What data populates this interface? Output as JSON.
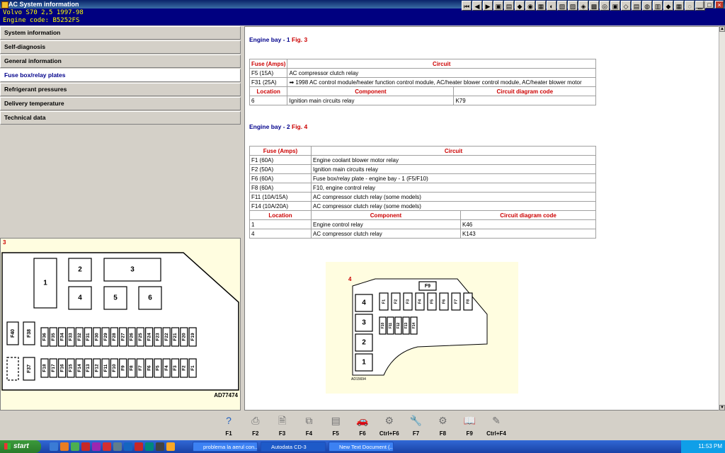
{
  "window": {
    "title": "AC System information"
  },
  "header": {
    "vehicle": "Volvo   S70  2,5  1997-98",
    "engine": "Engine code: B5252FS"
  },
  "menu": [
    {
      "label": "System information"
    },
    {
      "label": "Self-diagnosis"
    },
    {
      "label": "General information"
    },
    {
      "label": "Fuse box/relay plates",
      "selected": true
    },
    {
      "label": "Refrigerant pressures"
    },
    {
      "label": "Delivery temperature"
    },
    {
      "label": "Technical data"
    }
  ],
  "left_diagram": {
    "number": "3",
    "code": "AD77474",
    "relays": [
      "1",
      "2",
      "3",
      "4",
      "5",
      "6"
    ],
    "side_fuses": [
      "F40",
      "F38",
      "F37"
    ],
    "top_row": [
      "F36",
      "F35",
      "F34",
      "F33",
      "F32",
      "F31",
      "F30",
      "F29",
      "F28",
      "F27",
      "F26",
      "F25",
      "F24",
      "F23",
      "F22",
      "F21",
      "F20",
      "F19"
    ],
    "bottom_row": [
      "F18",
      "F17",
      "F16",
      "F15",
      "F14",
      "F13",
      "F12",
      "F11",
      "F10",
      "F9",
      "F8",
      "F7",
      "F6",
      "F5",
      "F4",
      "F3",
      "F2",
      "F1"
    ]
  },
  "section1": {
    "heading": "Engine bay - 1",
    "fig": "Fig. 3",
    "fuse_headers": [
      "Fuse (Amps)",
      "Circuit"
    ],
    "fuses": [
      [
        "F5 (15A)",
        "AC compressor clutch relay"
      ],
      [
        "F31 (25A)",
        "1998 AC control module/heater function control module, AC/heater blower control module, AC/heater blower motor"
      ]
    ],
    "relay_headers": [
      "Location",
      "Component",
      "Circuit diagram code"
    ],
    "relays": [
      [
        "6",
        "Ignition main circuits relay",
        "K79"
      ]
    ]
  },
  "section2": {
    "heading": "Engine bay - 2",
    "fig": "Fig. 4",
    "fuse_headers": [
      "Fuse (Amps)",
      "Circuit"
    ],
    "fuses": [
      [
        "F1 (60A)",
        "Engine coolant blower motor relay"
      ],
      [
        "F2 (50A)",
        "Ignition main circuits relay"
      ],
      [
        "F6 (60A)",
        "Fuse box/relay plate - engine bay - 1 (F5/F10)"
      ],
      [
        "F8 (60A)",
        "F10, engine control relay"
      ],
      [
        "F11 (10A/15A)",
        "AC compressor clutch relay (some models)"
      ],
      [
        "F14 (10A/20A)",
        "AC compressor clutch relay (some models)"
      ]
    ],
    "relay_headers": [
      "Location",
      "Component",
      "Circuit diagram code"
    ],
    "relays": [
      [
        "1",
        "Engine control relay",
        "K46"
      ],
      [
        "4",
        "AC compressor clutch relay",
        "K143"
      ]
    ]
  },
  "right_diagram": {
    "number": "4",
    "code": "AD15694",
    "top_fuse": "F9",
    "relays": [
      "4",
      "3",
      "2",
      "1"
    ],
    "fuses_top": [
      "F1",
      "F2",
      "F3",
      "F4",
      "F5",
      "F6",
      "F7",
      "F8"
    ],
    "fuses_mid": [
      "F10",
      "F11",
      "F12",
      "F13",
      "F14"
    ]
  },
  "fkeys": [
    {
      "label": "F1",
      "icon": "help-icon",
      "color": "#2060c0"
    },
    {
      "label": "F2",
      "icon": "print-icon",
      "color": "#707070"
    },
    {
      "label": "F3",
      "icon": "print-preview-icon",
      "color": "#707070"
    },
    {
      "label": "F4",
      "icon": "copy-icon",
      "color": "#707070"
    },
    {
      "label": "F5",
      "icon": "document-icon",
      "color": "#707070"
    },
    {
      "label": "F6",
      "icon": "car-icon",
      "color": "#30a030"
    },
    {
      "label": "Ctrl+F6",
      "icon": "car-parts-icon",
      "color": "#707070"
    },
    {
      "label": "F7",
      "icon": "wrench-icon",
      "color": "#707070"
    },
    {
      "label": "F8",
      "icon": "engine-icon",
      "color": "#707070"
    },
    {
      "label": "F9",
      "icon": "book-icon",
      "color": "#707070"
    },
    {
      "label": "Ctrl+F4",
      "icon": "notes-icon",
      "color": "#707070"
    }
  ],
  "taskbar": {
    "start": "start",
    "tasks": [
      "problema la aerul con...",
      "Autodata CD-3",
      "New Text Document (..."
    ],
    "clock": "11:53 PM"
  }
}
